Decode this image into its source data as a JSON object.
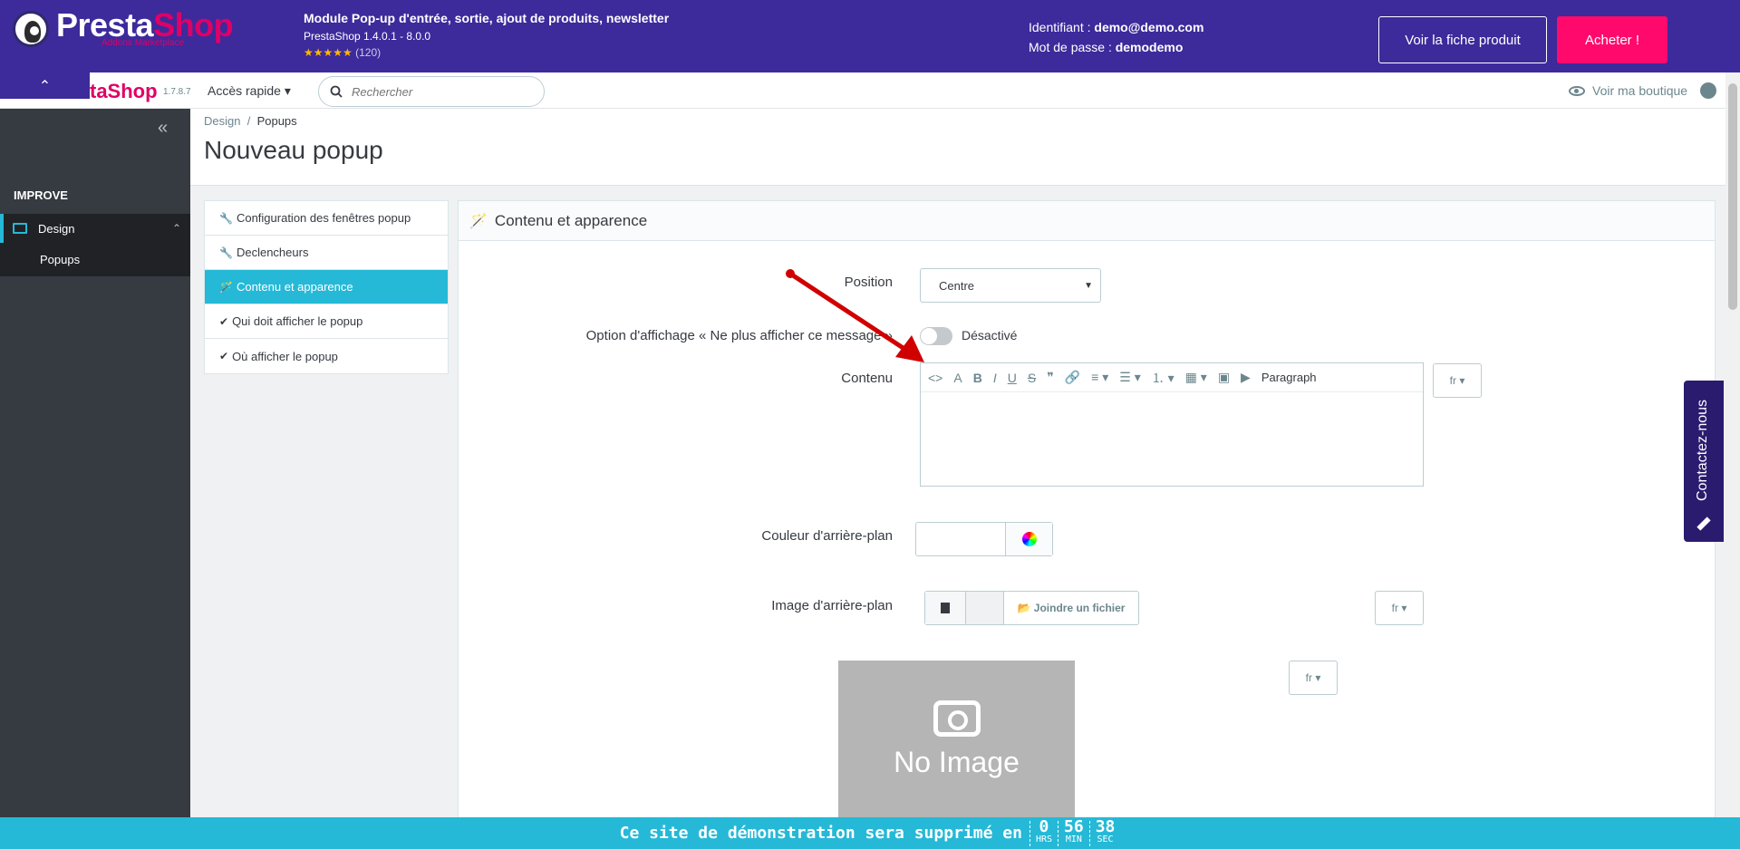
{
  "demo_bar": {
    "logo_part1": "Presta",
    "logo_part2": "Shop",
    "logo_sub": "Addons Marketplace",
    "module_title": "Module Pop-up d'entrée, sortie, ajout de produits, newsletter",
    "module_version": "PrestaShop 1.4.0.1 - 8.0.0",
    "stars": "★★★★★",
    "rating_count": "(120)",
    "id_label": "Identifiant : ",
    "id_value": "demo@demo.com",
    "pw_label": "Mot de passe : ",
    "pw_value": "demodemo",
    "btn_fiche": "Voir la fiche produit",
    "btn_acheter": "Acheter !"
  },
  "header": {
    "logo": "taShop",
    "version": "1.7.8.7",
    "quick_access": "Accès rapide ▾",
    "search_placeholder": "Rechercher",
    "view_shop": "Voir ma boutique",
    "collapse": "⌃"
  },
  "sidebar": {
    "collapse": "«",
    "section": "IMPROVE",
    "design": "Design",
    "popups": "Popups"
  },
  "page": {
    "breadcrumb_1": "Design",
    "breadcrumb_sep": "/",
    "breadcrumb_2": "Popups",
    "title": "Nouveau popup"
  },
  "tabs": [
    {
      "icon": "🔧",
      "label": "Configuration des fenêtres popup"
    },
    {
      "icon": "🔧",
      "label": "Declencheurs"
    },
    {
      "icon": "🪄",
      "label": "Contenu et apparence"
    },
    {
      "icon": "✔",
      "label": "Qui doit afficher le popup"
    },
    {
      "icon": "✔",
      "label": "Où afficher le popup"
    }
  ],
  "panel": {
    "title": "Contenu et apparence",
    "position_label": "Position",
    "position_value": "Centre",
    "option_label": "Option d'affichage « Ne plus afficher ce message »",
    "toggle_label": "Désactivé",
    "content_label": "Contenu",
    "toolbar": [
      "<>",
      "A",
      "B",
      "I",
      "U",
      "S",
      "❞",
      "🔗",
      "≡ ▾",
      "☰ ▾",
      "⒈ ▾",
      "▦ ▾",
      "▣",
      "▶"
    ],
    "toolbar_format": "Paragraph",
    "lang": "fr ▾",
    "bgcolor_label": "Couleur d'arrière-plan",
    "bgimage_label": "Image d'arrière-plan",
    "attach_label": "📂 Joindre un fichier",
    "no_image": "No Image"
  },
  "contact_tab": "Contactez-nous",
  "countdown": {
    "text": "Ce site de démonstration sera supprimé en",
    "hours": "0",
    "hours_unit": "HRS",
    "minutes": "56",
    "minutes_unit": "MIN",
    "seconds": "38",
    "seconds_unit": "SEC"
  }
}
